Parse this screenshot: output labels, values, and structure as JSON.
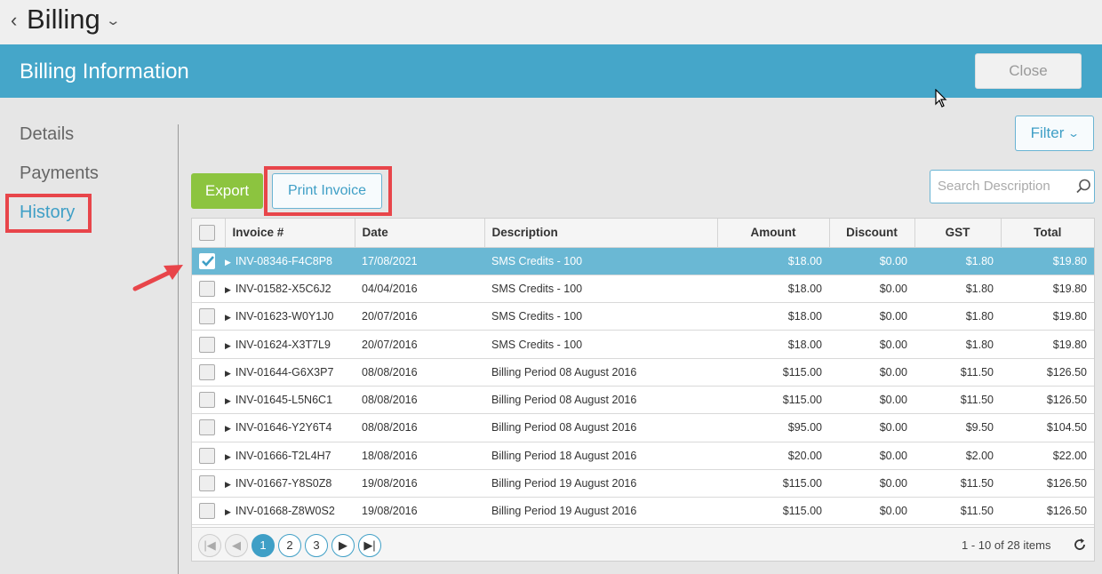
{
  "topbar": {
    "back_icon": "‹",
    "title": "Billing",
    "title_chevron": "⌄"
  },
  "header": {
    "title": "Billing Information",
    "close_label": "Close"
  },
  "nav": {
    "items": [
      {
        "label": "Details"
      },
      {
        "label": "Payments"
      },
      {
        "label": "History"
      }
    ],
    "active": "History"
  },
  "toolbar": {
    "filter_label": "Filter",
    "export_label": "Export",
    "print_label": "Print Invoice"
  },
  "search": {
    "placeholder": "Search Description",
    "value": ""
  },
  "table": {
    "columns": [
      "Invoice #",
      "Date",
      "Description",
      "Amount",
      "Discount",
      "GST",
      "Total"
    ],
    "rows": [
      {
        "invoice": "INV-08346-F4C8P8",
        "date": "17/08/2021",
        "description": "SMS Credits - 100",
        "amount": "$18.00",
        "discount": "$0.00",
        "gst": "$1.80",
        "total": "$19.80",
        "selected": true
      },
      {
        "invoice": "INV-01582-X5C6J2",
        "date": "04/04/2016",
        "description": "SMS Credits - 100",
        "amount": "$18.00",
        "discount": "$0.00",
        "gst": "$1.80",
        "total": "$19.80"
      },
      {
        "invoice": "INV-01623-W0Y1J0",
        "date": "20/07/2016",
        "description": "SMS Credits - 100",
        "amount": "$18.00",
        "discount": "$0.00",
        "gst": "$1.80",
        "total": "$19.80"
      },
      {
        "invoice": "INV-01624-X3T7L9",
        "date": "20/07/2016",
        "description": "SMS Credits - 100",
        "amount": "$18.00",
        "discount": "$0.00",
        "gst": "$1.80",
        "total": "$19.80"
      },
      {
        "invoice": "INV-01644-G6X3P7",
        "date": "08/08/2016",
        "description": "Billing Period 08 August 2016",
        "amount": "$115.00",
        "discount": "$0.00",
        "gst": "$11.50",
        "total": "$126.50"
      },
      {
        "invoice": "INV-01645-L5N6C1",
        "date": "08/08/2016",
        "description": "Billing Period 08 August 2016",
        "amount": "$115.00",
        "discount": "$0.00",
        "gst": "$11.50",
        "total": "$126.50"
      },
      {
        "invoice": "INV-01646-Y2Y6T4",
        "date": "08/08/2016",
        "description": "Billing Period 08 August 2016",
        "amount": "$95.00",
        "discount": "$0.00",
        "gst": "$9.50",
        "total": "$104.50"
      },
      {
        "invoice": "INV-01666-T2L4H7",
        "date": "18/08/2016",
        "description": "Billing Period 18 August 2016",
        "amount": "$20.00",
        "discount": "$0.00",
        "gst": "$2.00",
        "total": "$22.00"
      },
      {
        "invoice": "INV-01667-Y8S0Z8",
        "date": "19/08/2016",
        "description": "Billing Period 19 August 2016",
        "amount": "$115.00",
        "discount": "$0.00",
        "gst": "$11.50",
        "total": "$126.50"
      },
      {
        "invoice": "INV-01668-Z8W0S2",
        "date": "19/08/2016",
        "description": "Billing Period 19 August 2016",
        "amount": "$115.00",
        "discount": "$0.00",
        "gst": "$11.50",
        "total": "$126.50"
      }
    ]
  },
  "pager": {
    "first_icon": "|◀",
    "prev_icon": "◀",
    "pages": [
      "1",
      "2",
      "3"
    ],
    "current": "1",
    "next_icon": "▶",
    "last_icon": "▶|",
    "info": "1 - 10 of 28 items",
    "refresh_icon": "refresh-icon"
  },
  "colors": {
    "header": "#45a6c9",
    "accent": "#3f9fc6",
    "export": "#8cc43f",
    "selected_row": "#6ab8d4",
    "highlight": "#e8454a"
  }
}
